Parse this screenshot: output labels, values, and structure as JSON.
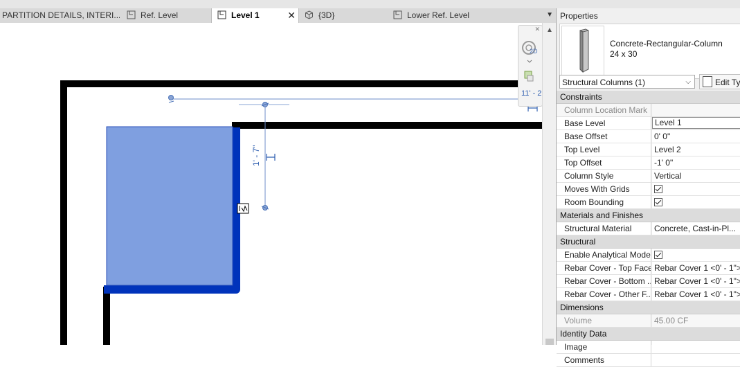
{
  "tabs": [
    {
      "label": "PARTITION DETAILS, INTERI...",
      "icon": "section-view-icon"
    },
    {
      "label": "Ref. Level",
      "icon": "floor-plan-icon"
    },
    {
      "label": "Level 1",
      "icon": "floor-plan-icon",
      "active": true
    },
    {
      "label": "{3D}",
      "icon": "3d-view-icon"
    },
    {
      "label": "Lower Ref. Level",
      "icon": "floor-plan-icon"
    }
  ],
  "canvas": {
    "dimension_label": "1' - 7\"",
    "nav_dimension_label": "11' - 2",
    "nav_2d_label": "2D"
  },
  "properties": {
    "title": "Properties",
    "type_name_line1": "Concrete-Rectangular-Column",
    "type_name_line2": "24 x 30",
    "category_select": "Structural Columns (1)",
    "edit_type_label": "Edit Ty",
    "groups": [
      {
        "name": "Constraints",
        "rows": [
          {
            "label": "Column Location Mark",
            "value": "",
            "dim": true
          },
          {
            "label": "Base Level",
            "value": "Level 1",
            "boxed": true
          },
          {
            "label": "Base Offset",
            "value": "0'  0\""
          },
          {
            "label": "Top Level",
            "value": "Level 2"
          },
          {
            "label": "Top Offset",
            "value": "-1'  0\""
          },
          {
            "label": "Column Style",
            "value": "Vertical"
          },
          {
            "label": "Moves With Grids",
            "checkbox": true
          },
          {
            "label": "Room Bounding",
            "checkbox": true
          }
        ]
      },
      {
        "name": "Materials and Finishes",
        "rows": [
          {
            "label": "Structural Material",
            "value": "Concrete, Cast-in-Pl..."
          }
        ]
      },
      {
        "name": "Structural",
        "rows": [
          {
            "label": "Enable Analytical Model",
            "checkbox": true
          },
          {
            "label": "Rebar Cover - Top Face",
            "value": "Rebar Cover 1 <0' - 1\">"
          },
          {
            "label": "Rebar Cover - Bottom ...",
            "value": "Rebar Cover 1 <0' - 1\">"
          },
          {
            "label": "Rebar Cover - Other F...",
            "value": "Rebar Cover 1 <0' - 1\">"
          }
        ]
      },
      {
        "name": "Dimensions",
        "rows": [
          {
            "label": "Volume",
            "value": "45.00 CF",
            "dim": true
          }
        ]
      },
      {
        "name": "Identity Data",
        "rows": [
          {
            "label": "Image",
            "value": ""
          },
          {
            "label": "Comments",
            "value": ""
          }
        ]
      }
    ]
  },
  "colors": {
    "column_fill": "#7f9fe0",
    "column_outline": "#0033bb",
    "wall": "#000000",
    "dimension": "#4a72b8"
  }
}
